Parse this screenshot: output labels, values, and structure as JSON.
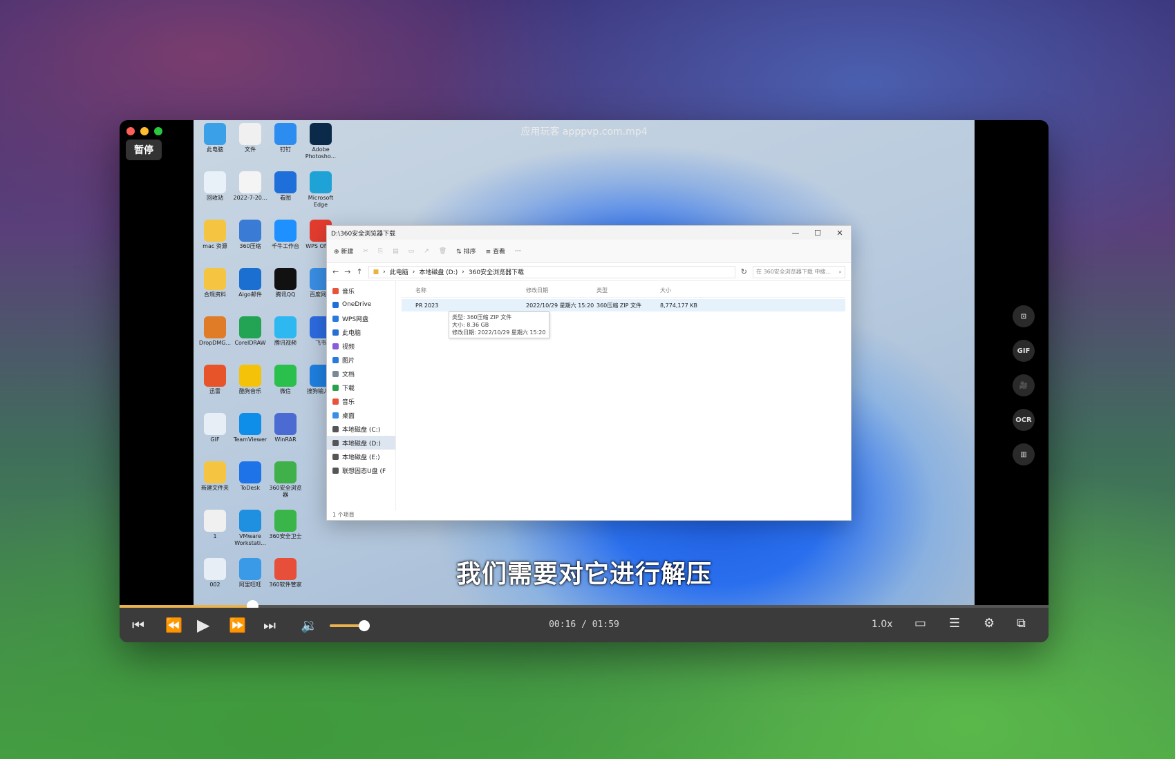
{
  "player": {
    "title": "应用玩客 apppvp.com.mp4",
    "pause_badge": "暂停",
    "subtitle": "我们需要对它进行解压",
    "time_current": "00:16",
    "time_separator": "/",
    "time_total": "01:59",
    "progress_fraction": 0.143,
    "volume_fraction": 0.9,
    "speed": "1.0x",
    "side_tools": [
      {
        "label": "⊡",
        "icon": "crop-icon"
      },
      {
        "label": "GIF",
        "icon": "gif-icon"
      },
      {
        "label": "🎥",
        "icon": "record-icon"
      },
      {
        "label": "OCR",
        "icon": "ocr-icon"
      },
      {
        "label": "▥",
        "icon": "layout-icon"
      }
    ]
  },
  "desktop_icons": [
    {
      "label": "此电脑",
      "color": "#3aa0e8"
    },
    {
      "label": "文件",
      "color": "#f0f0f0"
    },
    {
      "label": "钉钉",
      "color": "#2d8cf0"
    },
    {
      "label": "Adobe Photosho...",
      "color": "#0b2a4a"
    },
    {
      "label": "回收站",
      "color": "#e8f0f8"
    },
    {
      "label": "2022-7-20...",
      "color": "#f4f4f4"
    },
    {
      "label": "看图",
      "color": "#1e6fd9"
    },
    {
      "label": "Microsoft Edge",
      "color": "#1fa3d6"
    },
    {
      "label": "mac 资源",
      "color": "#f5c542"
    },
    {
      "label": "360压缩",
      "color": "#3a7bd5"
    },
    {
      "label": "千牛工作台",
      "color": "#1e90ff"
    },
    {
      "label": "WPS Office",
      "color": "#e43c2f"
    },
    {
      "label": "合规资料",
      "color": "#f5c542"
    },
    {
      "label": "Aigo邮件",
      "color": "#1a6fd0"
    },
    {
      "label": "腾讯QQ",
      "color": "#111"
    },
    {
      "label": "百度网盘",
      "color": "#3a8ee6"
    },
    {
      "label": "DropDMG...",
      "color": "#e07b28"
    },
    {
      "label": "CorelDRAW",
      "color": "#23a454"
    },
    {
      "label": "腾讯视频",
      "color": "#2db8f2"
    },
    {
      "label": "飞书",
      "color": "#2c6be0"
    },
    {
      "label": "迅雷",
      "color": "#e8542a"
    },
    {
      "label": "酷狗音乐",
      "color": "#f5c20a"
    },
    {
      "label": "微信",
      "color": "#2bbf4b"
    },
    {
      "label": "搜狗输入法",
      "color": "#1f7fe0"
    },
    {
      "label": "GIF",
      "color": "#e8eef5"
    },
    {
      "label": "TeamViewer",
      "color": "#0e8ee9"
    },
    {
      "label": "WinRAR",
      "color": "#4b6bd3"
    },
    {
      "label": "",
      "color": "#fff"
    },
    {
      "label": "新建文件夹",
      "color": "#f5c542"
    },
    {
      "label": "ToDesk",
      "color": "#1e73e8"
    },
    {
      "label": "360安全浏览器",
      "color": "#3fb04a"
    },
    {
      "label": "",
      "color": "#fff"
    },
    {
      "label": "1",
      "color": "#f0f0f0"
    },
    {
      "label": "VMware Workstati...",
      "color": "#1f8fe0"
    },
    {
      "label": "360安全卫士",
      "color": "#39b54a"
    },
    {
      "label": "",
      "color": "#fff"
    },
    {
      "label": "002",
      "color": "#e8eef5"
    },
    {
      "label": "阿里旺旺",
      "color": "#3a9ae8"
    },
    {
      "label": "360软件管家",
      "color": "#e84f3a"
    }
  ],
  "explorer": {
    "window_title": "D:\\360安全浏览器下载",
    "toolbar": {
      "new": "⊕ 新建",
      "sort": "⇅ 排序",
      "view": "≡ 查看",
      "more": "···"
    },
    "breadcrumb": [
      "此电脑",
      "本地磁盘 (D:)",
      "360安全浏览器下载"
    ],
    "search_placeholder": "在 360安全浏览器下载 中搜...",
    "sidebar": [
      {
        "label": "音乐",
        "color": "#e8543a",
        "selected": false
      },
      {
        "label": "OneDrive",
        "color": "#1f6fd6",
        "selected": false
      },
      {
        "label": "WPS网盘",
        "color": "#2a7ad9",
        "selected": false
      },
      {
        "label": "此电脑",
        "color": "#2a6fd0",
        "selected": false
      },
      {
        "label": "视频",
        "color": "#8a5cd6",
        "selected": false
      },
      {
        "label": "图片",
        "color": "#2a7ad9",
        "selected": false
      },
      {
        "label": "文档",
        "color": "#7a8898",
        "selected": false
      },
      {
        "label": "下载",
        "color": "#29a04b",
        "selected": false
      },
      {
        "label": "音乐",
        "color": "#e8543a",
        "selected": false
      },
      {
        "label": "桌面",
        "color": "#3a8ee6",
        "selected": false
      },
      {
        "label": "本地磁盘 (C:)",
        "color": "#555",
        "selected": false
      },
      {
        "label": "本地磁盘 (D:)",
        "color": "#555",
        "selected": true
      },
      {
        "label": "本地磁盘 (E:)",
        "color": "#555",
        "selected": false
      },
      {
        "label": "联想固态U盘 (F",
        "color": "#555",
        "selected": false
      }
    ],
    "columns": [
      "名称",
      "修改日期",
      "类型",
      "大小"
    ],
    "rows": [
      {
        "name": "PR 2023",
        "date": "2022/10/29 星期六 15:20",
        "type": "360压缩 ZIP 文件",
        "size": "8,774,177 KB"
      }
    ],
    "tooltip": [
      "类型: 360压缩 ZIP 文件",
      "大小: 8.36 GB",
      "修改日期: 2022/10/29 星期六 15:20"
    ],
    "status": "1 个项目"
  }
}
